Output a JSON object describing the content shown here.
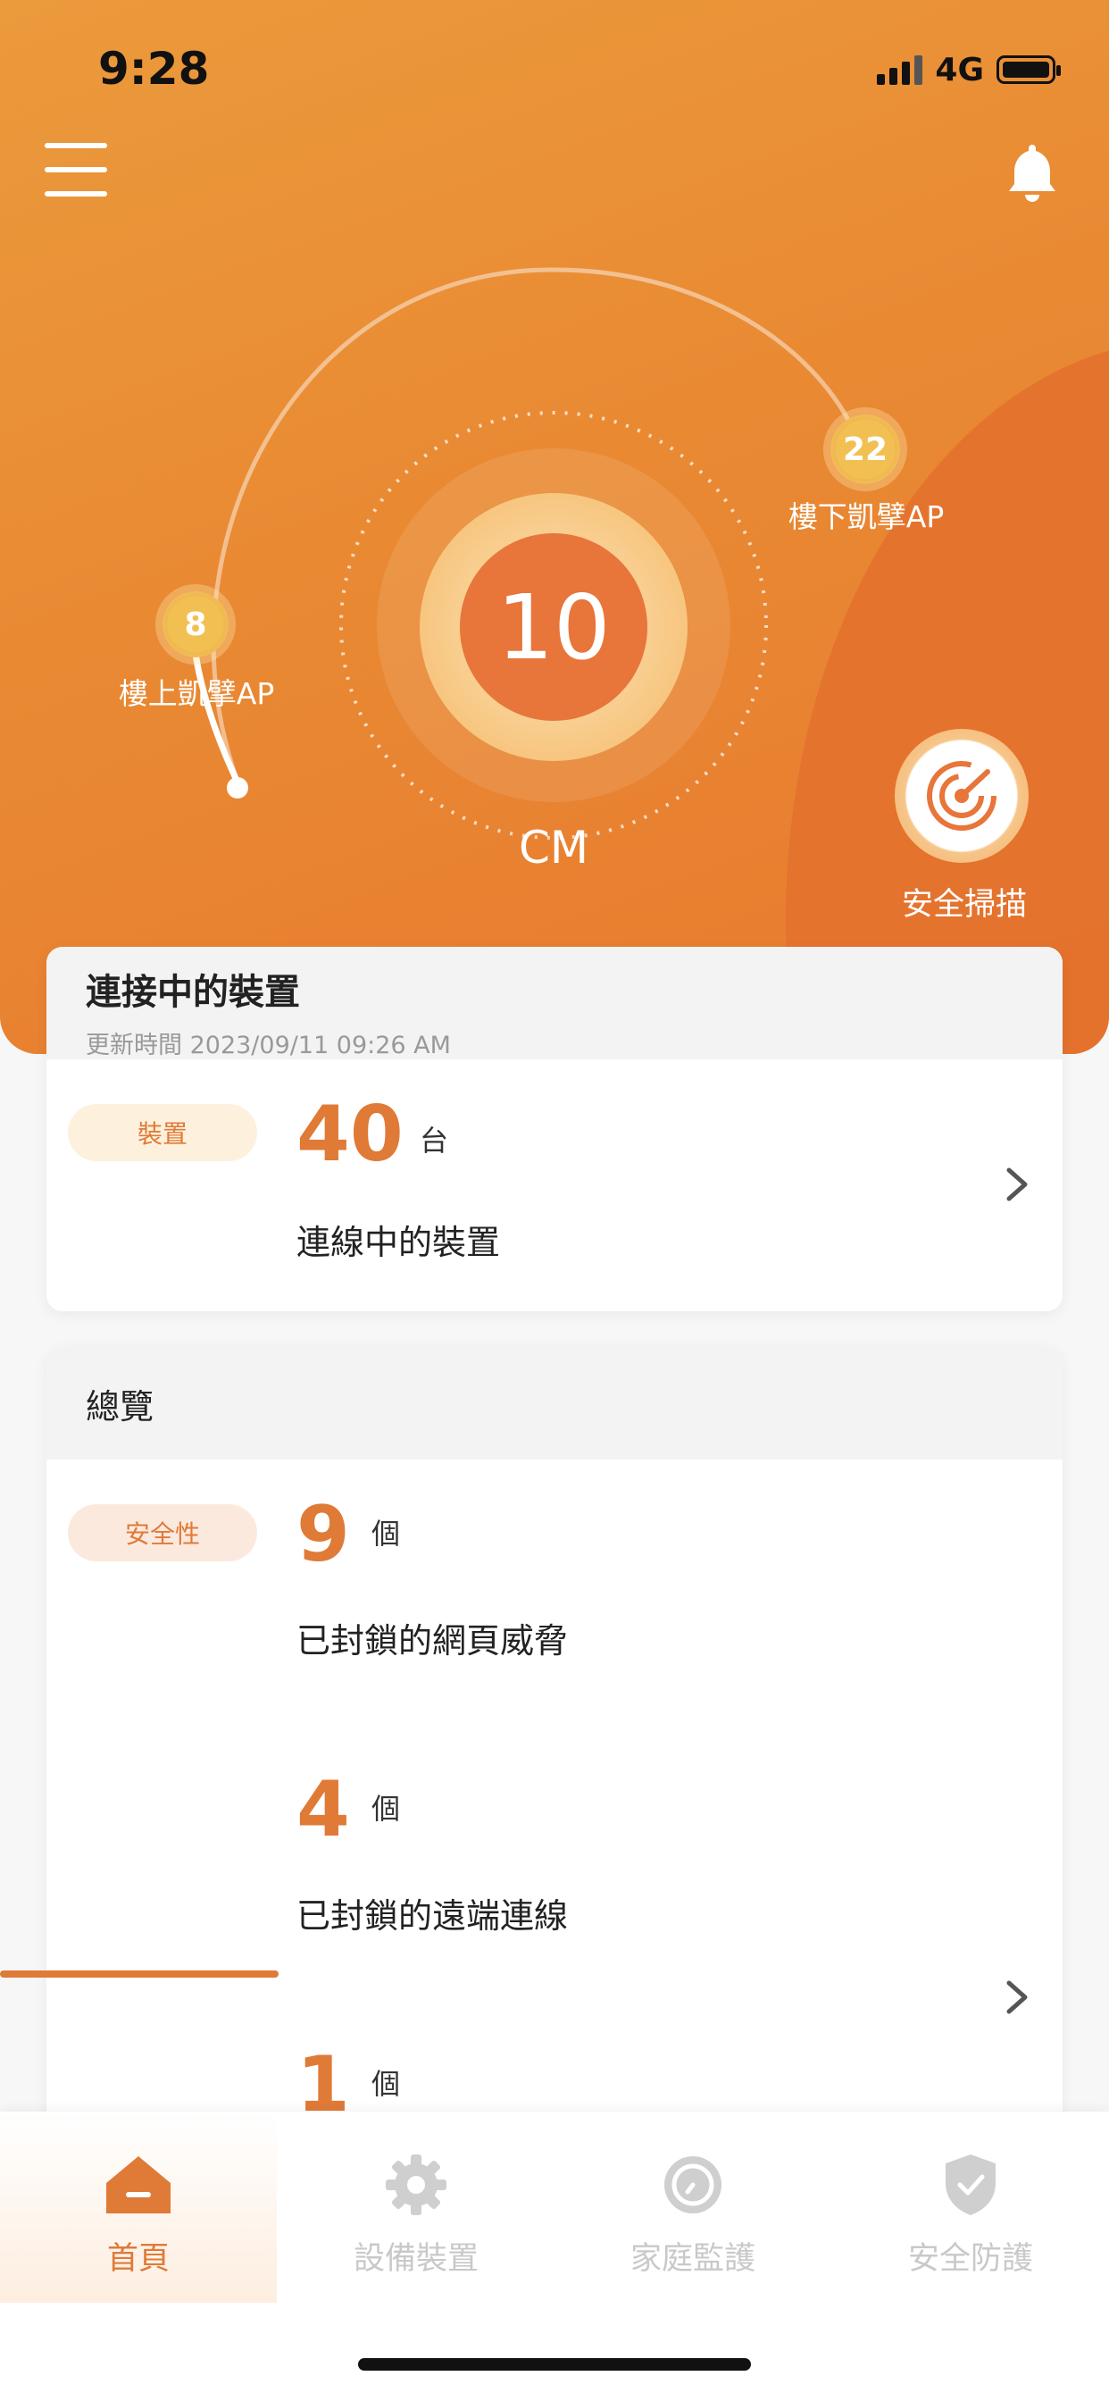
{
  "status_bar": {
    "time": "9:28",
    "network": "4G"
  },
  "header": {
    "menu_icon": "hamburger-menu-icon",
    "bell_icon": "bell-icon"
  },
  "hero": {
    "center_value": "10",
    "center_label": "CM",
    "access_points": [
      {
        "count": "8",
        "label": "樓上凱擘AP"
      },
      {
        "count": "22",
        "label": "樓下凱擘AP"
      }
    ],
    "scan_label": "安全掃描",
    "colors": {
      "accent": "#e07a37",
      "bubble": "#f2c052"
    }
  },
  "connected_card": {
    "title": "連接中的裝置",
    "updated": "更新時間 2023/09/11 09:26 AM",
    "pill": "裝置",
    "count": "40",
    "unit": "台",
    "description": "連線中的裝置"
  },
  "overview_card": {
    "title": "總覽",
    "pill": "安全性",
    "items": [
      {
        "count": "9",
        "unit": "個",
        "description": "已封鎖的網頁威脅"
      },
      {
        "count": "4",
        "unit": "個",
        "description": "已封鎖的遠端連線"
      },
      {
        "count": "1",
        "unit": "個"
      }
    ]
  },
  "tabbar": {
    "tabs": [
      {
        "label": "首頁",
        "icon": "home-icon",
        "active": true
      },
      {
        "label": "設備裝置",
        "icon": "gear-icon",
        "active": false
      },
      {
        "label": "家庭監護",
        "icon": "clock-icon",
        "active": false
      },
      {
        "label": "安全防護",
        "icon": "shield-check-icon",
        "active": false
      }
    ]
  }
}
